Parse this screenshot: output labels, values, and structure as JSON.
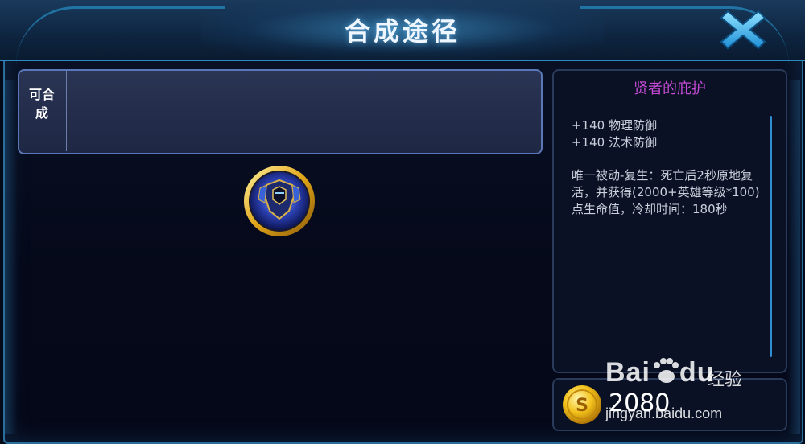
{
  "header": {
    "title": "合成途径"
  },
  "close": {
    "icon": "close-icon"
  },
  "composable": {
    "label": "可合成"
  },
  "item": {
    "icon": "armor-item-icon",
    "name": "贤者的庇护",
    "name_color": "#c64bd6",
    "stats": [
      "+140 物理防御",
      "+140 法术防御"
    ],
    "description": "唯一被动-复生：死亡后2秒原地复活，并获得(2000+英雄等级*100)点生命值，冷却时间：180秒"
  },
  "price": {
    "icon": "gold-coin-icon",
    "value": "2080"
  },
  "watermark": {
    "brand": "Bai",
    "brand_suffix": "du",
    "cn": "经验",
    "url": "jingyan.baidu.com"
  },
  "colors": {
    "accent": "#2aa7e6",
    "close": "#3cb8f0",
    "coin": "#f3c21b"
  }
}
